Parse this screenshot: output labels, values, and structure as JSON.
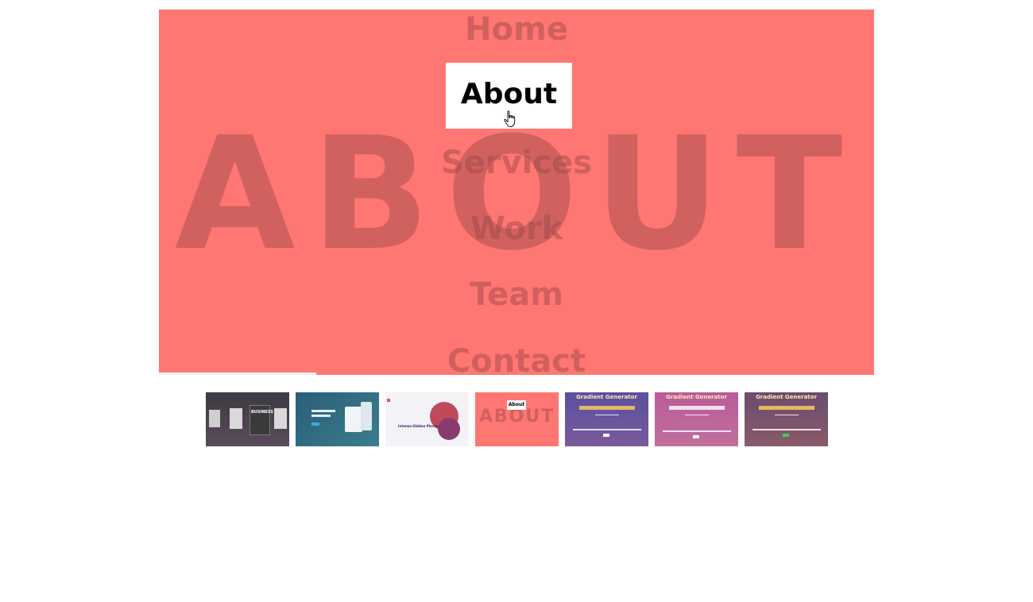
{
  "slide": {
    "background_word": "ABOUT",
    "menu": [
      {
        "label": "Home",
        "active": false
      },
      {
        "label": "About",
        "active": true
      },
      {
        "label": "Services",
        "active": false
      },
      {
        "label": "Work",
        "active": false
      },
      {
        "label": "Team",
        "active": false
      },
      {
        "label": "Contact",
        "active": false
      }
    ],
    "accent_color": "#ff7672"
  },
  "thumbnails": [
    {
      "label": "BUSINESS"
    },
    {
      "label": ""
    },
    {
      "label": "Intense Hidden Places"
    },
    {
      "label": "About",
      "bg_word": "ABOUT"
    },
    {
      "label": "Gradient Generator"
    },
    {
      "label": "Gradient Generator"
    },
    {
      "label": "Gradient Generator"
    }
  ],
  "progress": 0.22
}
